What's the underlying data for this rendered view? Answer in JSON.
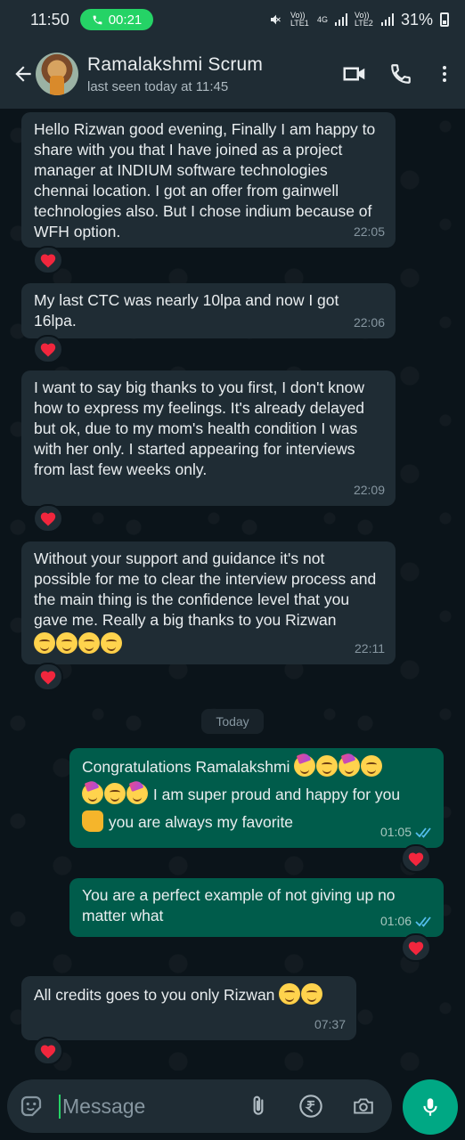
{
  "status_bar": {
    "time": "11:50",
    "call_timer": "00:21",
    "network_1": "Vo)) LTE1",
    "network_2": "Vo)) LTE2",
    "network_type": "4G",
    "battery": "31%"
  },
  "header": {
    "contact_name": "Ramalakshmi Scrum",
    "last_seen": "last seen today at 11:45"
  },
  "messages": [
    {
      "dir": "in",
      "text": "Hello Rizwan good evening, Finally I am happy to share with you that I have joined as a project manager at INDIUM software technologies chennai location. I got an offer from gainwell technologies also. But I chose indium because of WFH option.",
      "time": "22:05",
      "reaction": "heart"
    },
    {
      "dir": "in",
      "text": "My last CTC was nearly 10lpa and  now I got 16lpa.",
      "time": "22:06",
      "reaction": "heart"
    },
    {
      "dir": "in",
      "text": "I want to say big thanks to you first, I don't know how to express my feelings. It's already delayed but ok, due to my mom's health condition I was with her only. I started appearing for interviews from last few weeks only.",
      "time": "22:09",
      "reaction": "heart"
    },
    {
      "dir": "in",
      "text": "Without your support and guidance it's not possible for me to clear the interview process and the main thing is the confidence level that you gave me. Really a big thanks to you Rizwan",
      "emoji": "☺☺☺☺",
      "time": "22:11",
      "reaction": "heart"
    },
    {
      "dir": "out",
      "line1": "Congratulations Ramalakshmi",
      "line2": "I am super proud and happy for you",
      "line3": "you are always my favorite",
      "time": "01:05",
      "reaction": "heart"
    },
    {
      "dir": "out",
      "text": "You are a perfect example of not giving up no matter what",
      "time": "01:06",
      "reaction": "heart"
    },
    {
      "dir": "in",
      "text": "All credits goes to you only Rizwan",
      "time": "07:37",
      "reaction": "heart"
    }
  ],
  "date_divider": "Today",
  "composer": {
    "placeholder": "Message"
  },
  "colors": {
    "incoming": "#1f2c34",
    "outgoing": "#005c4b",
    "accent": "#00a884",
    "background": "#0b141a"
  },
  "icons": [
    "back-arrow-icon",
    "video-call-icon",
    "voice-call-icon",
    "more-vert-icon",
    "sticker-icon",
    "attach-icon",
    "rupee-icon",
    "camera-icon",
    "mic-icon",
    "heart-icon",
    "read-ticks-icon"
  ]
}
